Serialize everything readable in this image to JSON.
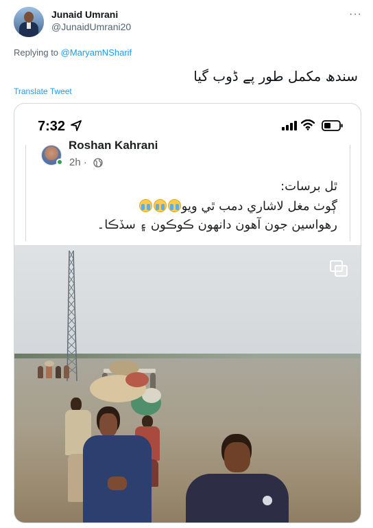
{
  "tweet": {
    "author_name": "Junaid Umrani",
    "author_handle": "@JunaidUmrani20",
    "more_label": "···",
    "replying_prefix": "Replying to ",
    "replying_to": "@MaryamNSharif",
    "text": "سندھ مکمل طور پے  ڈوب گیا",
    "translate_label": "Translate Tweet"
  },
  "phone_status": {
    "time": "7:32"
  },
  "fb_post": {
    "author_name": "Roshan Kahrani",
    "time": "2h ·",
    "line1": "ٿل برسات:",
    "line2": "ڳوٺ مغل لاشاري دمب ٿي ويو",
    "line3": "رهواسين جون آهون دانهون ڪوڪون ۽ سڏڪا۔"
  },
  "colors": {
    "accent": "#1d9bf0",
    "secondary_text": "#536471",
    "online": "#31a24c"
  },
  "icons": [
    "more-icon",
    "location-arrow-icon",
    "signal-icon",
    "wifi-icon",
    "battery-icon",
    "globe-icon",
    "crying-emoji-icon",
    "fullscreen-icon"
  ]
}
